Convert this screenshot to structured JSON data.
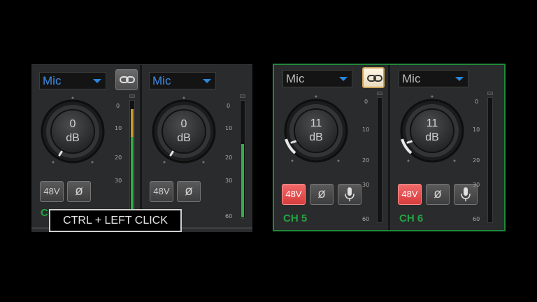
{
  "left_group": {
    "link_active": false,
    "channels": [
      {
        "input": "Mic",
        "gain_value": "0",
        "gain_unit": "dB",
        "phantom_label": "48V",
        "phase_symbol": "ø",
        "label": "CH"
      },
      {
        "input": "Mic",
        "gain_value": "0",
        "gain_unit": "dB",
        "phantom_label": "48V",
        "phase_symbol": "ø"
      }
    ],
    "meter_scale": [
      "0",
      "10",
      "20",
      "30",
      "60"
    ]
  },
  "right_group": {
    "link_active": true,
    "channels": [
      {
        "input": "Mic",
        "gain_value": "11",
        "gain_unit": "dB",
        "phantom_label": "48V",
        "phase_symbol": "ø",
        "label": "CH 5"
      },
      {
        "input": "Mic",
        "gain_value": "11",
        "gain_unit": "dB",
        "phantom_label": "48V",
        "phase_symbol": "ø",
        "label": "CH 6"
      }
    ],
    "meter_scale": [
      "0",
      "10",
      "20",
      "30",
      "60"
    ]
  },
  "tooltip": "CTRL + LEFT CLICK",
  "colors": {
    "accent_blue": "#3c8be6",
    "group_border": "#1f8a3a",
    "channel_label": "#24a443",
    "phantom_on": "#e34848"
  }
}
